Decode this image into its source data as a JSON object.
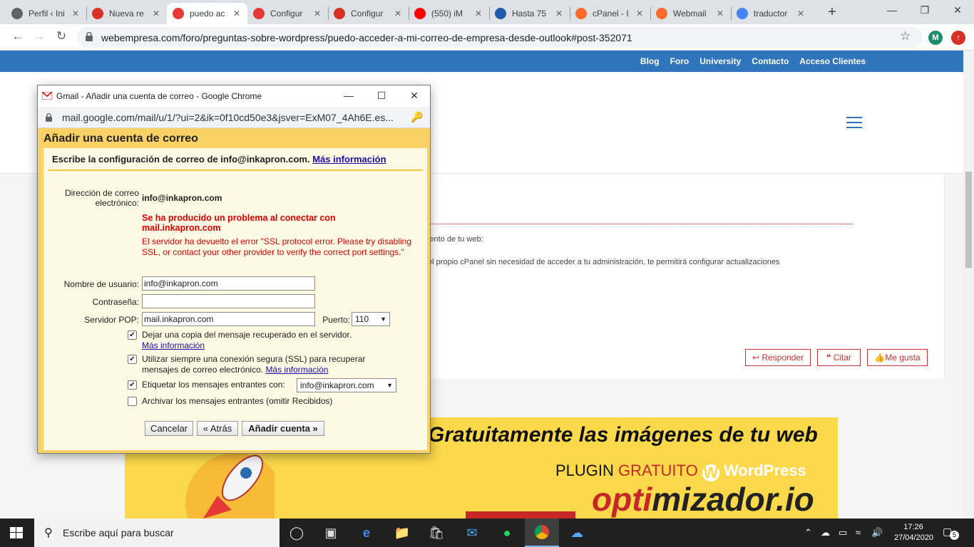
{
  "browser": {
    "tabs": [
      {
        "label": "Perfil ‹ Ini",
        "icon": "wordpress-icon",
        "color": "#5f6368"
      },
      {
        "label": "Nueva re",
        "icon": "gmail-icon",
        "color": "#d93025"
      },
      {
        "label": "puedo ac",
        "icon": "webempresa-icon",
        "color": "#e53935",
        "active": true
      },
      {
        "label": "Configur",
        "icon": "webempresa-icon",
        "color": "#e53935"
      },
      {
        "label": "Configur",
        "icon": "gmail-icon",
        "color": "#d93025"
      },
      {
        "label": "(550) iM",
        "icon": "youtube-icon",
        "color": "#ff0000"
      },
      {
        "label": "Hasta 75",
        "icon": "mail-icon",
        "color": "#1e5ba8"
      },
      {
        "label": "cPanel - I",
        "icon": "cpanel-icon",
        "color": "#ff6c2c"
      },
      {
        "label": "Webmail",
        "icon": "cpanel-icon",
        "color": "#ff6c2c"
      },
      {
        "label": "traductor",
        "icon": "google-icon",
        "color": "#4285f4"
      }
    ],
    "new_tab": "+",
    "url": "webempresa.com/foro/preguntas-sobre-wordpress/puedo-acceder-a-mi-correo-de-empresa-desde-outlook#post-352071",
    "profile_initial": "M",
    "profile_color": "#1e8e6e"
  },
  "site": {
    "nav": [
      "Blog",
      "Foro",
      "University",
      "Contacto",
      "Acceso Clientes"
    ],
    "nav_color": "#2f75bb",
    "post_line1": "iento de tu web:",
    "post_line2": "el propio cPanel sin necesidad de acceder a tu administración, te permitirá configurar actualizaciones",
    "buttons": {
      "reply": "Responder",
      "quote": "Citar",
      "like": "Me gusta"
    },
    "banner": {
      "title": "Gratuitamente las imágenes de tu web",
      "plugin": "PLUGIN",
      "gratuito": "GRATUITO",
      "wordpress": "WordPress",
      "brand_a": "opti",
      "brand_b": "mizador.io"
    }
  },
  "popup": {
    "window_title": "Gmail - Añadir una cuenta de correo - Google Chrome",
    "url": "mail.google.com/mail/u/1/?ui=2&ik=0f10cd50e3&jsver=ExM07_4Ah6E.es...",
    "heading": "Añadir una cuenta de correo",
    "subheading": "Escribe la configuración de correo de info@inkapron.com.",
    "more_info": "Más información",
    "email_label_1": "Dirección de correo",
    "email_label_2": "electrónico:",
    "email_value": "info@inkapron.com",
    "error_title": "Se ha producido un problema al conectar con mail.inkapron.com",
    "error_detail": "El servidor ha devuelto el error \"SSL protocol error. Please try disabling SSL, or contact your other provider to verify the correct port settings.\"",
    "username_label": "Nombre de usuario:",
    "username_value": "info@inkapron.com",
    "password_label": "Contraseña:",
    "password_value": "",
    "server_label": "Servidor POP:",
    "server_value": "mail.inkapron.com",
    "port_label": "Puerto:",
    "port_value": "110",
    "opt_copy": "Dejar una copia del mensaje recuperado en el servidor.",
    "opt_copy_link": "Más información",
    "opt_ssl_1": "Utilizar siempre una conexión segura (SSL) para recuperar",
    "opt_ssl_2": "mensajes de correo electrónico.",
    "opt_ssl_link": "Más información",
    "opt_label": "Etiquetar los mensajes entrantes con:",
    "opt_label_value": "info@inkapron.com",
    "opt_archive": "Archivar los mensajes entrantes (omitir Recibidos)",
    "cancel": "Cancelar",
    "back": "« Atrás",
    "add": "Añadir cuenta »",
    "checks": {
      "copy": true,
      "ssl": true,
      "label": true,
      "archive": false
    }
  },
  "taskbar": {
    "search_placeholder": "Escribe aquí para buscar",
    "time": "17:26",
    "date": "27/04/2020",
    "notifications": "5"
  }
}
